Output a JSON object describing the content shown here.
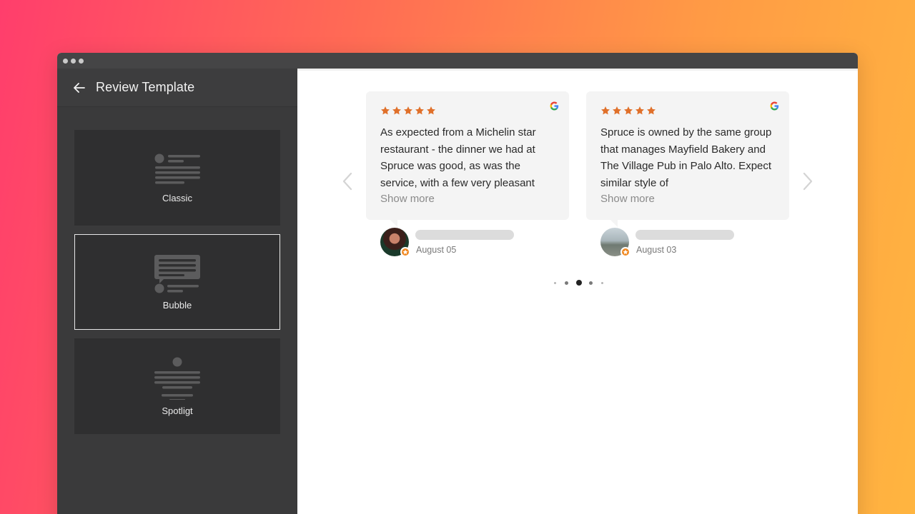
{
  "sidebar": {
    "title": "Review Template",
    "templates": [
      {
        "label": "Classic",
        "icon": "classic-layout-icon",
        "active": false
      },
      {
        "label": "Bubble",
        "icon": "bubble-layout-icon",
        "active": true
      },
      {
        "label": "Spotligt",
        "icon": "spotlight-layout-icon",
        "active": false
      }
    ]
  },
  "reviews": [
    {
      "rating": 5,
      "source_icon": "google-icon",
      "text": "As expected from a Michelin star restaurant - the dinner we had at Spruce was good, as was the service, with a few very pleasant",
      "show_more": "Show more",
      "date": "August 05"
    },
    {
      "rating": 5,
      "source_icon": "google-icon",
      "text": "Spruce is owned by the same group that manages Mayfield Bakery and The Village Pub in Palo Alto. Expect similar style of",
      "show_more": "Show more",
      "date": "August 03"
    }
  ],
  "carousel": {
    "page_count": 5,
    "active_page": 3
  },
  "colors": {
    "star": "#e0702a",
    "sidebar_bg": "#3a3a3b",
    "tile_bg": "#2f2f30",
    "bubble_bg": "#f4f4f4"
  }
}
